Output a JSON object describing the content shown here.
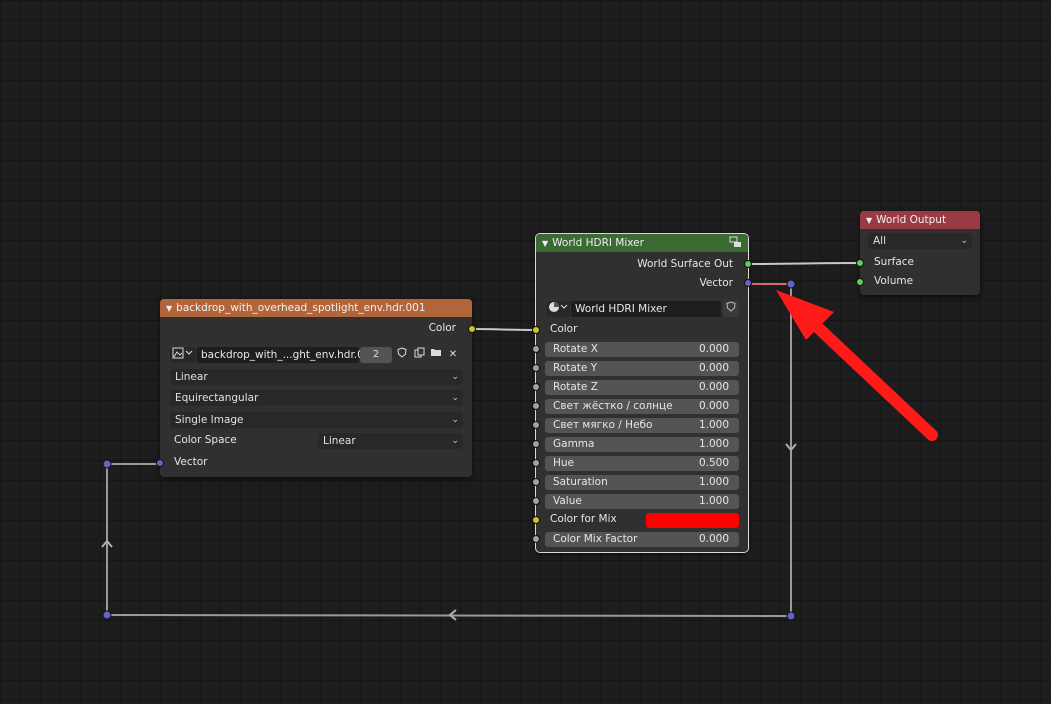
{
  "image_node": {
    "title": "backdrop_with_overhead_spotlight_env.hdr.001",
    "header_color": "#b2643a",
    "output_color_label": "Color",
    "image_name": "backdrop_with_...ght_env.hdr.001",
    "users_count": "2",
    "interpolation": "Linear",
    "projection": "Equirectangular",
    "source": "Single Image",
    "color_space_label": "Color Space",
    "color_space_value": "Linear",
    "vector_label": "Vector"
  },
  "mixer_node": {
    "title": "World HDRI Mixer",
    "header_color": "#3b6a33",
    "output_surface_label": "World Surface Out",
    "output_vector_label": "Vector",
    "group_name": "World HDRI Mixer",
    "color_label": "Color",
    "inputs": [
      {
        "label": "Rotate X",
        "value": "0.000"
      },
      {
        "label": "Rotate Y",
        "value": "0.000"
      },
      {
        "label": "Rotate Z",
        "value": "0.000"
      },
      {
        "label": "Свет жёстко / солнце",
        "value": "0.000"
      },
      {
        "label": "Свет мягко / Небо",
        "value": "1.000"
      },
      {
        "label": "Gamma",
        "value": "1.000"
      },
      {
        "label": "Hue",
        "value": "0.500"
      },
      {
        "label": "Saturation",
        "value": "1.000"
      },
      {
        "label": "Value",
        "value": "1.000"
      }
    ],
    "color_for_mix_label": "Color for Mix",
    "color_for_mix_swatch": "#ff0000",
    "color_mix_factor_label": "Color Mix Factor",
    "color_mix_factor_value": "0.000"
  },
  "output_node": {
    "title": "World Output",
    "header_color": "#9a3a44",
    "target": "All",
    "surface_label": "Surface",
    "volume_label": "Volume"
  },
  "annotation": {
    "arrow_color": "#ff1a1a"
  }
}
